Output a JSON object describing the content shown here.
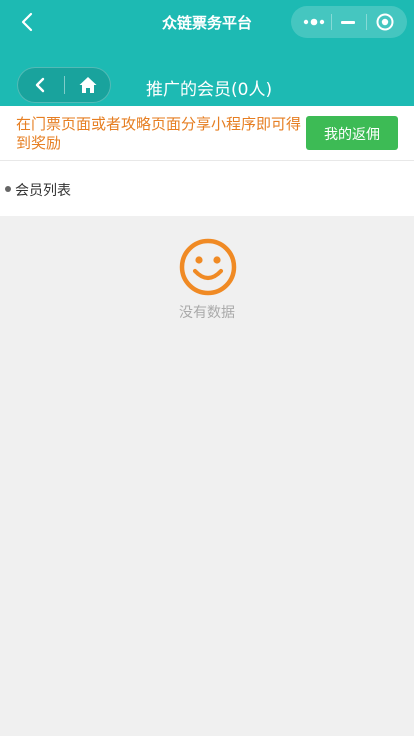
{
  "topbar": {
    "title": "众链票务平台",
    "icons": {
      "back": "chevron-left-icon",
      "more": "more-dots-icon",
      "minimize": "minimize-icon",
      "close": "circle-close-icon"
    }
  },
  "header": {
    "title": "推广的会员(0人)",
    "icons": {
      "back": "chevron-left-icon",
      "home": "home-icon"
    }
  },
  "notice": {
    "text": "在门票页面或者攻略页面分享小程序即可得到奖励",
    "button_label": "我的返佣"
  },
  "list": {
    "title": "会员列表"
  },
  "empty": {
    "icon": "smiley-icon",
    "text": "没有数据"
  },
  "colors": {
    "brand_teal": "#1dbab3",
    "notice_orange": "#e67e22",
    "button_green": "#3dbb55",
    "smiley_orange": "#f08a24"
  }
}
